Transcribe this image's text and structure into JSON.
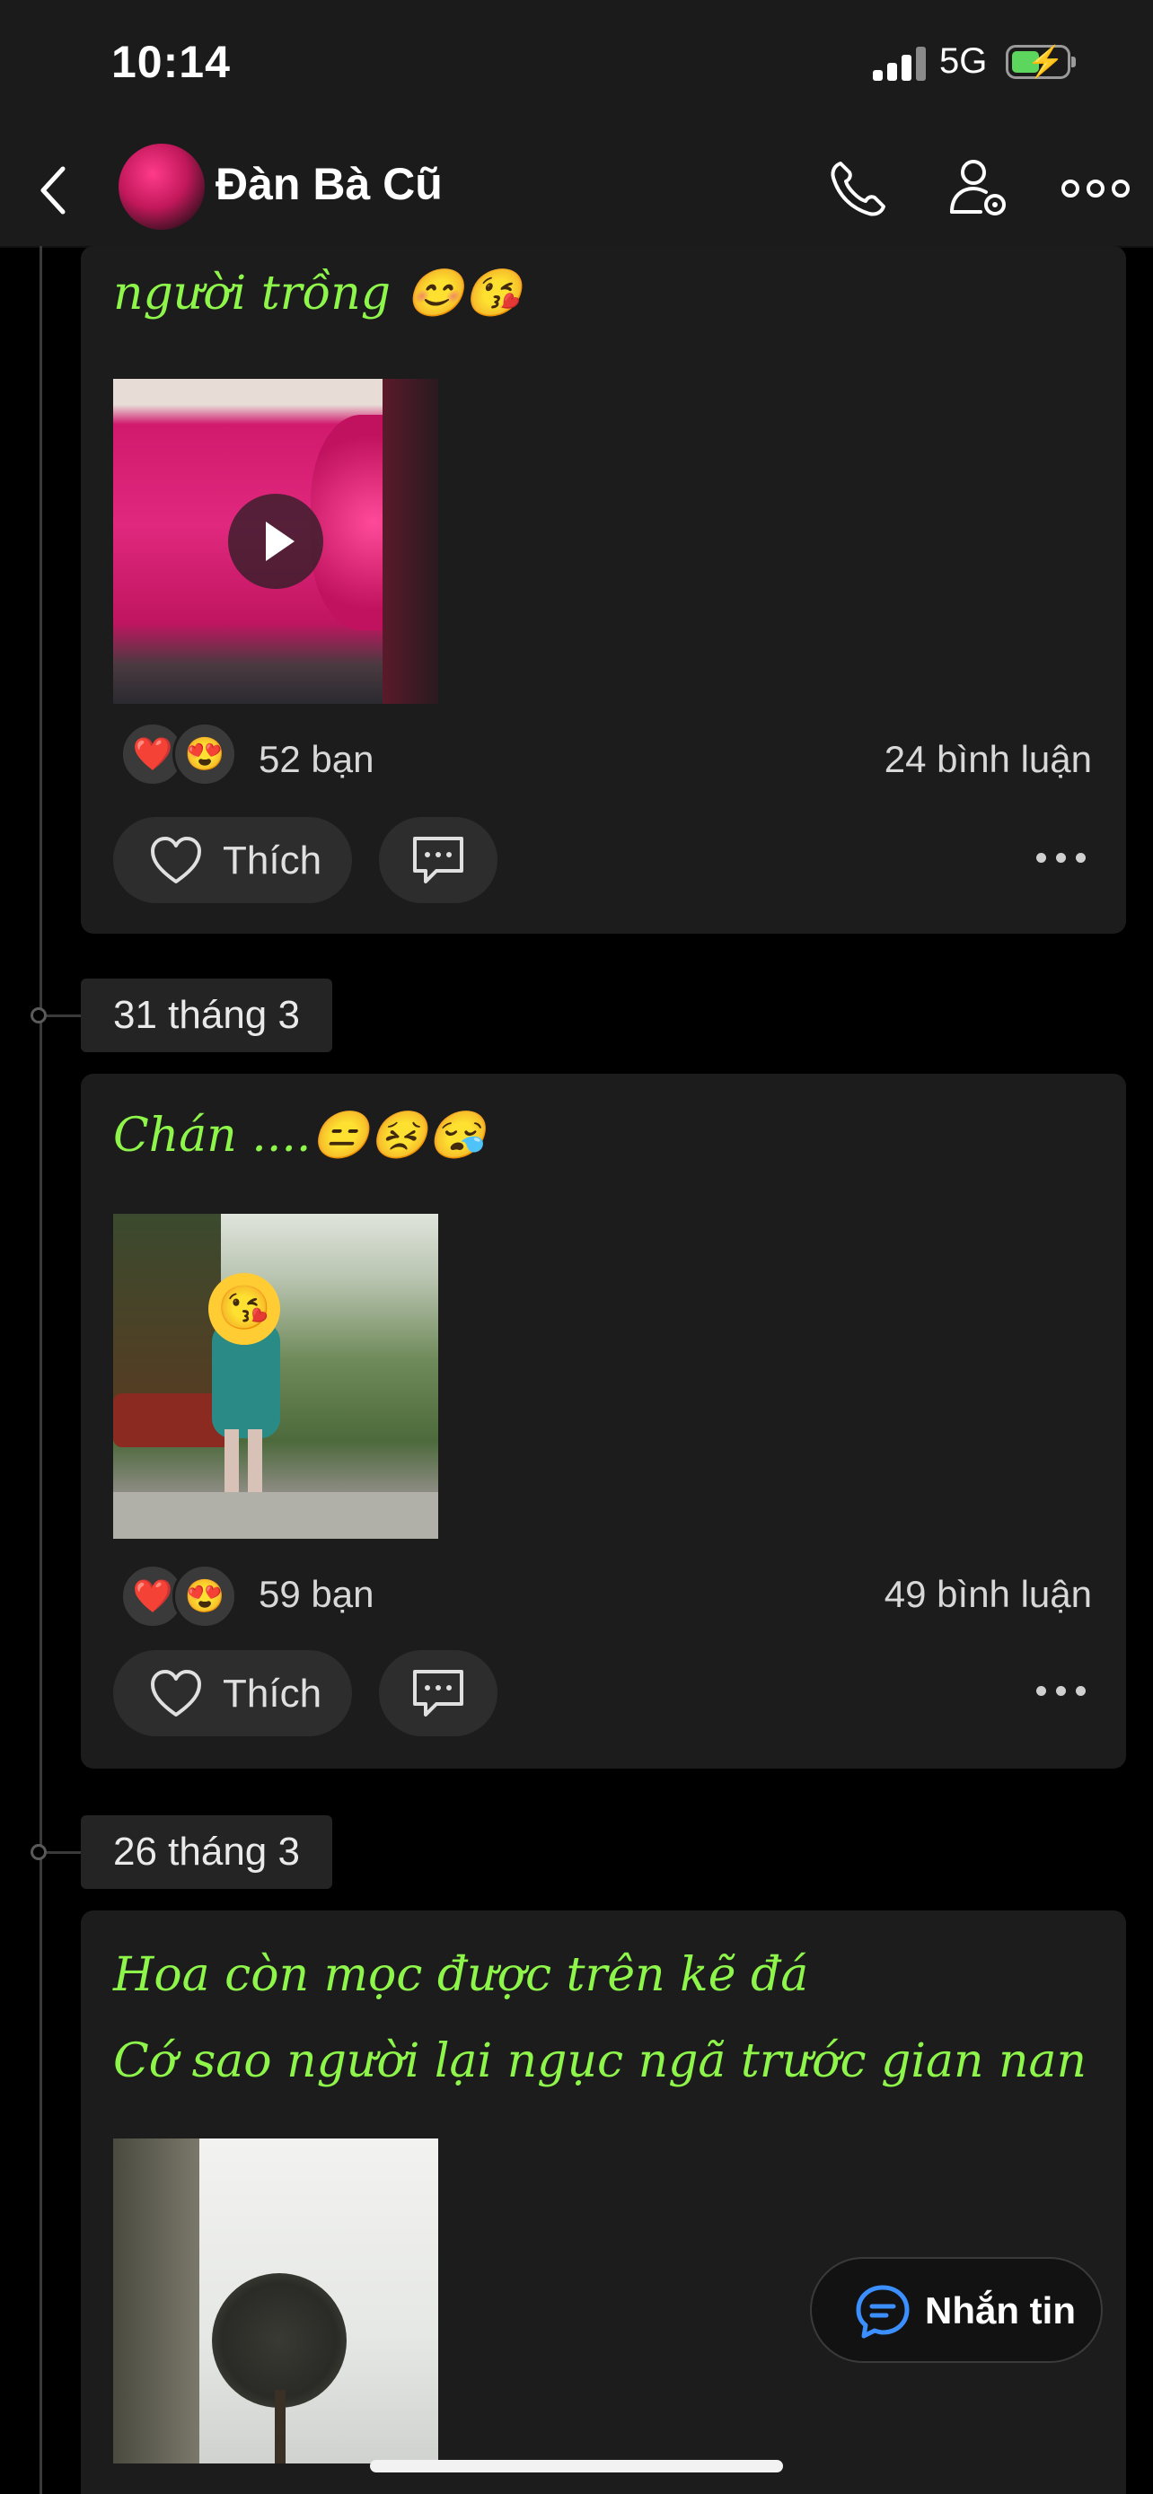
{
  "status_bar": {
    "time": "10:14",
    "network": "5G"
  },
  "header": {
    "title": "Đàn Bà Cũ"
  },
  "posts": [
    {
      "text_lines": [
        "người trồng 😊😘"
      ],
      "reactions": [
        "❤️",
        "😍"
      ],
      "reaction_count": "52 bạn",
      "comment_count": "24 bình luận",
      "like_label": "Thích"
    },
    {
      "date": "31 tháng 3",
      "text_lines": [
        "Chán ....😑😣😪"
      ],
      "reactions": [
        "❤️",
        "😍"
      ],
      "reaction_count": "59 bạn",
      "comment_count": "49 bình luận",
      "like_label": "Thích"
    },
    {
      "date": "26 tháng 3",
      "text_lines": [
        "Hoa còn mọc được trên kẽ đá",
        "Cớ sao người lại ngục ngã trước gian nan"
      ]
    }
  ],
  "message_button": {
    "label": "Nhắn tin"
  },
  "colors": {
    "post_text": "#8ef54a",
    "card": "#1c1c1c",
    "background": "#000000"
  }
}
